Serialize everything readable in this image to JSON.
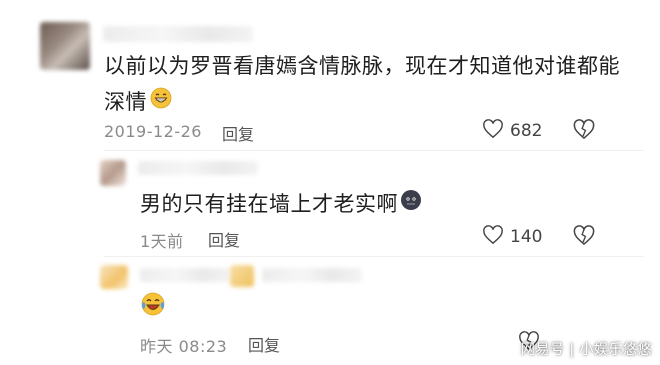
{
  "comments": [
    {
      "text_line1": "以前以为罗晋看唐嫣含情脉脉，现在才知道他对谁都能",
      "text_line2": "深情",
      "emoji": "grinning-face-emoji",
      "date": "2019-12-26",
      "reply_label": "回复",
      "likes": "682"
    },
    {
      "text": "男的只有挂在墙上才老实啊",
      "emoji": "dark-face-emoji",
      "date": "1天前",
      "reply_label": "回复",
      "likes": "140"
    },
    {
      "emoji": "crying-laughing-emoji",
      "date": "昨天 08:23",
      "reply_label": "回复"
    }
  ],
  "watermark": "网易号 | 小娱乐悠悠",
  "colors": {
    "text": "#1f1f1f",
    "meta": "#8a8a8a",
    "emoji_yellow": "#f6c23a",
    "emoji_dark": "#3b3d4a"
  }
}
